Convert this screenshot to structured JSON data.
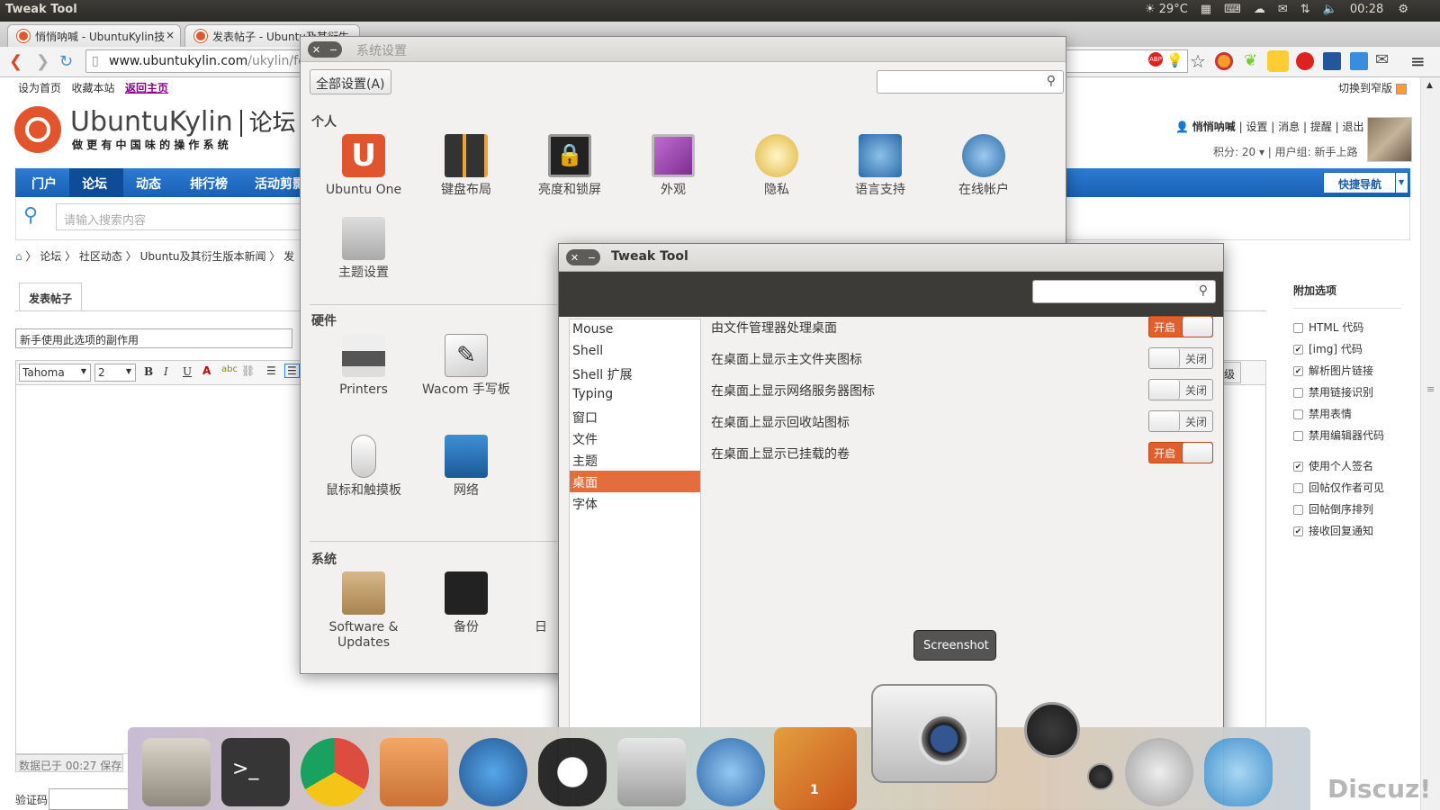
{
  "panel": {
    "title": "Tweak Tool",
    "weather": "29°C",
    "time": "00:28"
  },
  "browser": {
    "tabs": [
      {
        "label": "悄悄呐喊 - UbuntuKylin技"
      },
      {
        "label": "发表帖子 - Ubuntu及其衍生"
      }
    ],
    "url_host": "www.ubuntukylin.com",
    "url_path": "/ukylin/fo"
  },
  "forum": {
    "toplinks": [
      "设为首页",
      "收藏本站",
      "返回主页"
    ],
    "switch_width": "切换到窄版",
    "logo_main": "UbuntuKylin",
    "logo_sub": "论坛",
    "logo_tagline": "做 更 有 中 国 味 的 操 作 系 统",
    "user": {
      "name": "悄悄呐喊",
      "links": [
        "设置",
        "消息",
        "提醒",
        "退出"
      ],
      "points": "积分: 20",
      "group": "用户组: 新手上路"
    },
    "nav": [
      "门户",
      "论坛",
      "动态",
      "排行榜",
      "活动剪影"
    ],
    "quick_nav": "快捷导航",
    "search_placeholder": "请输入搜索内容",
    "breadcrumb": [
      "论坛",
      "社区动态",
      "Ubuntu及其衍生版本新闻",
      "发"
    ],
    "post_tab": "发表帖子",
    "subject_value": "新手使用此选项的副作用",
    "editor_font": "Tahoma",
    "editor_size": "2",
    "advanced": "高级",
    "autosave": "数据已于 00:27 保存",
    "captcha_label": "验证码",
    "extra_title": "附加选项",
    "options": [
      {
        "label": "HTML 代码",
        "checked": false
      },
      {
        "label": "[img] 代码",
        "checked": true
      },
      {
        "label": "解析图片链接",
        "checked": true
      },
      {
        "label": "禁用链接识别",
        "checked": false
      },
      {
        "label": "禁用表情",
        "checked": false
      },
      {
        "label": "禁用编辑器代码",
        "checked": false
      },
      {
        "label": "使用个人签名",
        "checked": true
      },
      {
        "label": "回帖仅作者可见",
        "checked": false
      },
      {
        "label": "回帖倒序排列",
        "checked": false
      },
      {
        "label": "接收回复通知",
        "checked": true
      }
    ],
    "discuz": "Discuz!"
  },
  "settings": {
    "title": "系统设置",
    "all_settings": "全部设置(A)",
    "sections": {
      "personal": "个人",
      "hardware": "硬件",
      "system": "系统"
    },
    "personal_items": [
      "Ubuntu One",
      "键盘布局",
      "亮度和锁屏",
      "外观",
      "隐私",
      "语言支持",
      "在线帐户",
      "主题设置"
    ],
    "hardware_items": [
      "Printers",
      "Wacom 手写板",
      "鼠标和触摸板",
      "网络"
    ],
    "system_items": [
      "Software & Updates",
      "备份",
      "日"
    ]
  },
  "tweak": {
    "title": "Tweak Tool",
    "categories": [
      "Mouse",
      "Shell",
      "Shell 扩展",
      "Typing",
      "窗口",
      "文件",
      "主题",
      "桌面",
      "字体"
    ],
    "selected": "桌面",
    "rows": [
      {
        "label": "由文件管理器处理桌面",
        "state": "开启",
        "on": true
      },
      {
        "label": "在桌面上显示主文件夹图标",
        "state": "关闭",
        "on": false
      },
      {
        "label": "在桌面上显示网络服务器图标",
        "state": "关闭",
        "on": false
      },
      {
        "label": "在桌面上显示回收站图标",
        "state": "关闭",
        "on": false
      },
      {
        "label": "在桌面上显示已挂载的卷",
        "state": "开启",
        "on": true
      }
    ]
  },
  "tooltip": "Screenshot",
  "dock_badge": "1",
  "colors": {
    "accent": "#e46d3b",
    "nav_blue": "#1f6cc4"
  }
}
